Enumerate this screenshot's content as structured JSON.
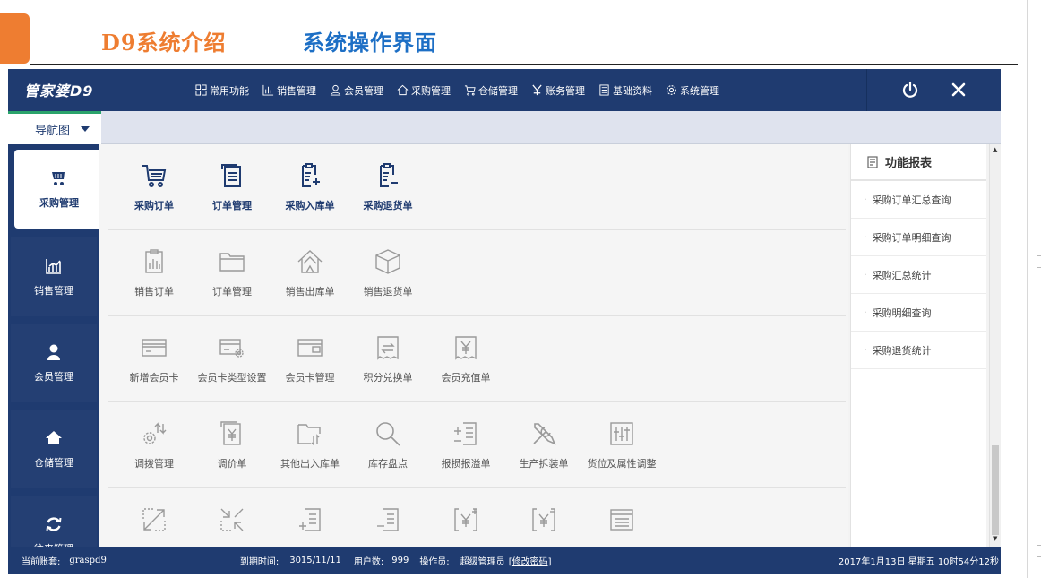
{
  "slide": {
    "title_left": "D9系统介绍",
    "title_right": "系统操作界面",
    "accent": "#ee7d31",
    "title_color": "#1d6fc5"
  },
  "app": {
    "logo": "管家婆D9",
    "menu": [
      {
        "label": "常用功能",
        "icon": "grid-icon"
      },
      {
        "label": "销售管理",
        "icon": "bar-chart-icon"
      },
      {
        "label": "会员管理",
        "icon": "user-icon"
      },
      {
        "label": "采购管理",
        "icon": "home-icon"
      },
      {
        "label": "仓储管理",
        "icon": "cart-icon"
      },
      {
        "label": "账务管理",
        "icon": "yen-icon"
      },
      {
        "label": "基础资料",
        "icon": "document-icon"
      },
      {
        "label": "系统管理",
        "icon": "gear-icon"
      }
    ],
    "nav_tab": "导航图",
    "sidebar": [
      {
        "label": "采购管理",
        "icon": "cart-icon",
        "active": true
      },
      {
        "label": "销售管理",
        "icon": "chart-icon",
        "active": false
      },
      {
        "label": "会员管理",
        "icon": "user-icon",
        "active": false
      },
      {
        "label": "仓储管理",
        "icon": "house-icon",
        "active": false
      },
      {
        "label": "往来管理",
        "icon": "refresh-icon",
        "active": false
      }
    ],
    "rows": [
      [
        "采购订单",
        "订单管理",
        "采购入库单",
        "采购退货单"
      ],
      [
        "销售订单",
        "订单管理",
        "销售出库单",
        "销售退货单"
      ],
      [
        "新增会员卡",
        "会员卡类型设置",
        "会员卡管理",
        "积分兑换单",
        "会员充值单"
      ],
      [
        "调拨管理",
        "调价单",
        "其他出入库单",
        "库存盘点",
        "报损报溢单",
        "生产拆装单",
        "货位及属性调整"
      ],
      [
        "",
        "",
        "",
        "",
        "",
        "",
        ""
      ]
    ],
    "report_panel": {
      "title": "功能报表",
      "items": [
        "采购订单汇总查询",
        "采购订单明细查询",
        "采购汇总统计",
        "采购明细查询",
        "采购退货统计"
      ]
    },
    "status": {
      "account_label": "当前账套:",
      "account_value": "graspd9",
      "expire_label": "到期时间:",
      "expire_value": "3015/11/11",
      "users_label": "用户数:",
      "users_value": "999",
      "operator_label": "操作员:",
      "operator_value": "超级管理员",
      "change_pwd": "[修改密码]",
      "datetime": "2017年1月13日 星期五 10时54分12秒"
    },
    "colors": {
      "header": "#1f3b70",
      "nav_accent": "#2aa36b",
      "content_bg": "#f5f5f5"
    }
  }
}
